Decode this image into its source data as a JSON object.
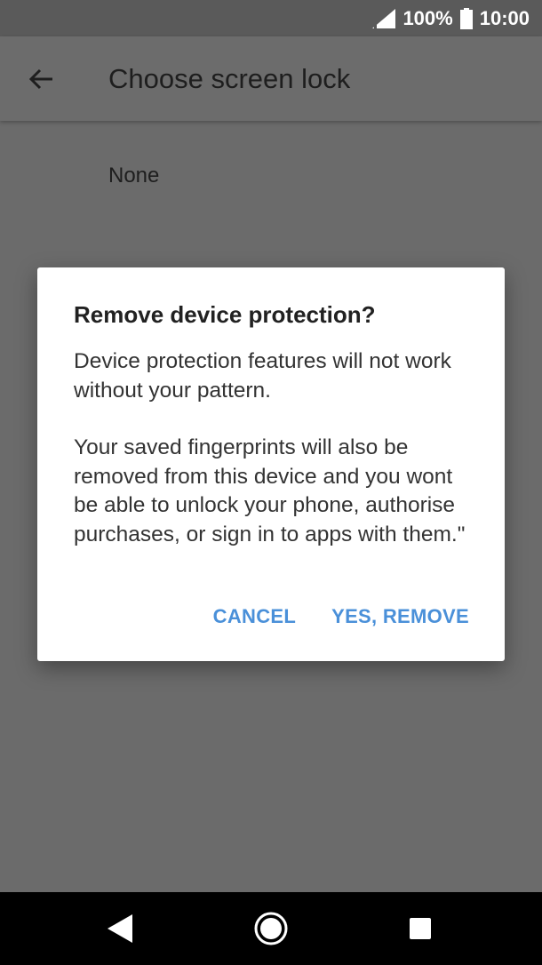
{
  "status_bar": {
    "battery_percent": "100%",
    "time": "10:00",
    "icons": [
      "signal-icon",
      "battery-icon"
    ]
  },
  "app_bar": {
    "title": "Choose screen lock",
    "back_icon": "arrow-left-icon"
  },
  "list": {
    "items": [
      {
        "label": "None"
      }
    ]
  },
  "dialog": {
    "title": "Remove device protection?",
    "paragraph_1": "Device protection features will not work without your pattern.",
    "paragraph_2": "Your saved fingerprints will also be removed from this device and you wont be able to unlock your phone, authorise purchases, or sign in to apps with them.\"",
    "cancel_label": "CANCEL",
    "confirm_label": "YES, REMOVE",
    "accent_color": "#4a90d9"
  },
  "nav_bar": {
    "icons": [
      "nav-back-icon",
      "nav-home-icon",
      "nav-recents-icon"
    ]
  }
}
